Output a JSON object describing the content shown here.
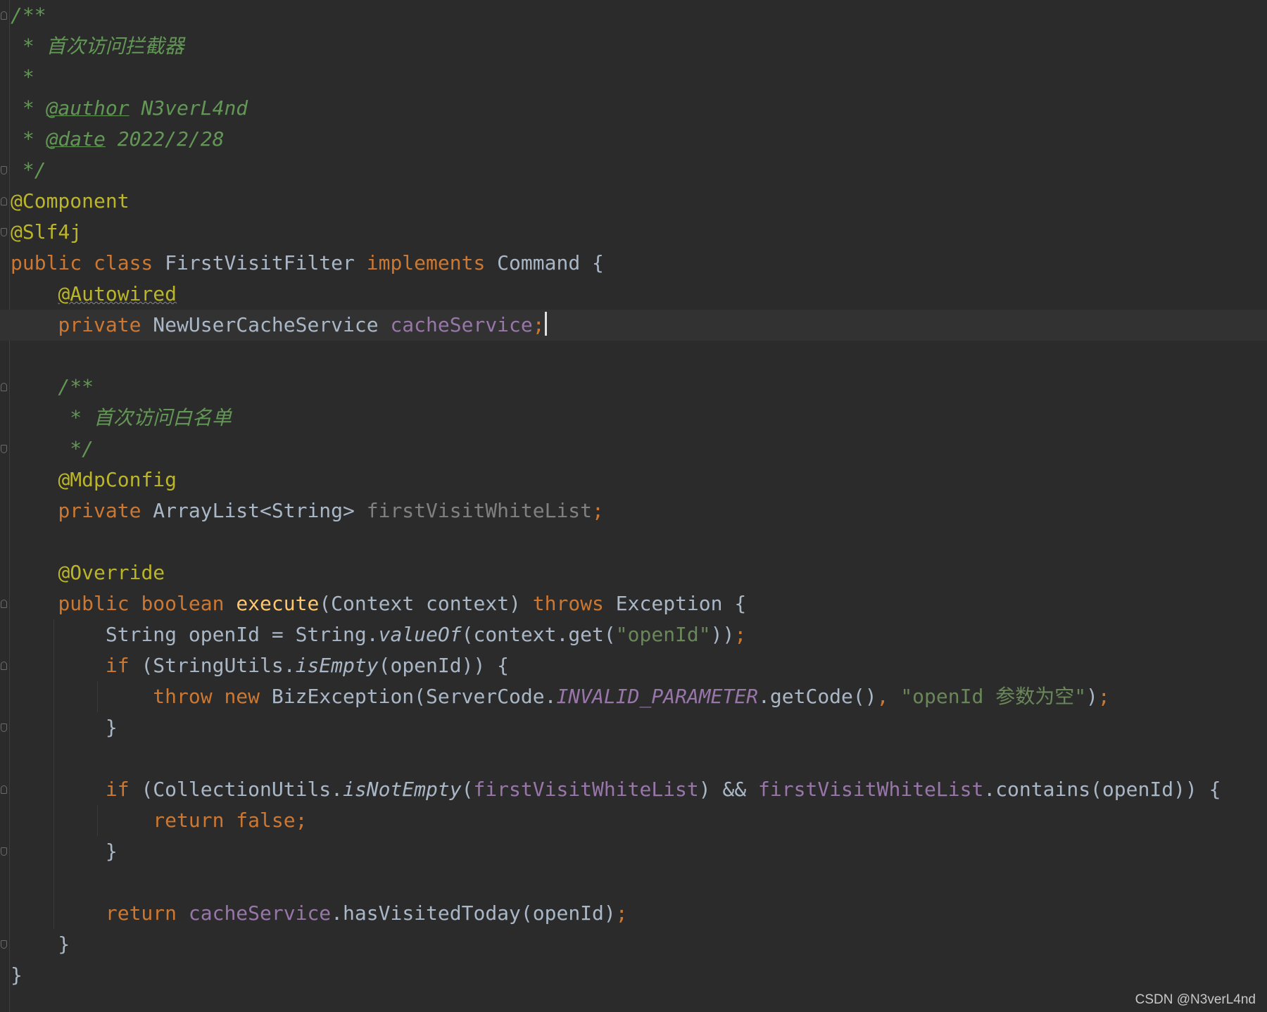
{
  "editor": {
    "lines": [
      [
        {
          "t": "/**",
          "c": "cm"
        }
      ],
      [
        {
          "t": " * 首次访问拦截器",
          "c": "cm"
        }
      ],
      [
        {
          "t": " *",
          "c": "cm"
        }
      ],
      [
        {
          "t": " * ",
          "c": "cm"
        },
        {
          "t": "@author",
          "c": "cmtag"
        },
        {
          "t": " N3verL4nd",
          "c": "cm"
        }
      ],
      [
        {
          "t": " * ",
          "c": "cm"
        },
        {
          "t": "@date",
          "c": "cmtag"
        },
        {
          "t": " 2022/2/28",
          "c": "cm"
        }
      ],
      [
        {
          "t": " */",
          "c": "cm"
        }
      ],
      [
        {
          "t": "@Component",
          "c": "ann"
        }
      ],
      [
        {
          "t": "@Slf4j",
          "c": "ann"
        }
      ],
      [
        {
          "t": "public class ",
          "c": "kw"
        },
        {
          "t": "FirstVisitFilter ",
          "c": "t"
        },
        {
          "t": "implements ",
          "c": "kw"
        },
        {
          "t": "Command {",
          "c": "t"
        }
      ],
      [
        {
          "t": "    ",
          "c": "t"
        },
        {
          "t": "@Autowired",
          "c": "ann squiggle"
        }
      ],
      [
        {
          "t": "    ",
          "c": "t"
        },
        {
          "t": "private ",
          "c": "kw"
        },
        {
          "t": "NewUserCacheService ",
          "c": "t"
        },
        {
          "t": "cacheService",
          "c": "fld"
        },
        {
          "t": ";",
          "c": "kw"
        },
        {
          "t": "",
          "c": "caret"
        }
      ],
      [],
      [
        {
          "t": "    /**",
          "c": "cm"
        }
      ],
      [
        {
          "t": "     * 首次访问白名单",
          "c": "cm"
        }
      ],
      [
        {
          "t": "     */",
          "c": "cm"
        }
      ],
      [
        {
          "t": "    ",
          "c": "t"
        },
        {
          "t": "@MdpConfig",
          "c": "ann"
        }
      ],
      [
        {
          "t": "    ",
          "c": "t"
        },
        {
          "t": "private ",
          "c": "kw"
        },
        {
          "t": "ArrayList<String> ",
          "c": "t"
        },
        {
          "t": "firstVisitWhiteList",
          "c": "fldgray"
        },
        {
          "t": ";",
          "c": "kw"
        }
      ],
      [],
      [
        {
          "t": "    ",
          "c": "t"
        },
        {
          "t": "@Override",
          "c": "ann"
        }
      ],
      [
        {
          "t": "    ",
          "c": "t"
        },
        {
          "t": "public boolean ",
          "c": "kw"
        },
        {
          "t": "execute",
          "c": "fn"
        },
        {
          "t": "(Context context) ",
          "c": "t"
        },
        {
          "t": "throws ",
          "c": "kw"
        },
        {
          "t": "Exception {",
          "c": "t"
        }
      ],
      [
        {
          "t": "        String openId = String.",
          "c": "t"
        },
        {
          "t": "valueOf",
          "c": "t ital"
        },
        {
          "t": "(context.get(",
          "c": "t"
        },
        {
          "t": "\"openId\"",
          "c": "str"
        },
        {
          "t": "))",
          "c": "t"
        },
        {
          "t": ";",
          "c": "kw"
        }
      ],
      [
        {
          "t": "        ",
          "c": "t"
        },
        {
          "t": "if ",
          "c": "kw"
        },
        {
          "t": "(StringUtils.",
          "c": "t"
        },
        {
          "t": "isEmpty",
          "c": "t ital"
        },
        {
          "t": "(openId)) {",
          "c": "t"
        }
      ],
      [
        {
          "t": "            ",
          "c": "t"
        },
        {
          "t": "throw new ",
          "c": "kw"
        },
        {
          "t": "BizException(ServerCode.",
          "c": "t"
        },
        {
          "t": "INVALID_PARAMETER",
          "c": "const"
        },
        {
          "t": ".getCode()",
          "c": "t"
        },
        {
          "t": ", ",
          "c": "kw"
        },
        {
          "t": "\"openId 参数为空\"",
          "c": "str"
        },
        {
          "t": ")",
          "c": "t"
        },
        {
          "t": ";",
          "c": "kw"
        }
      ],
      [
        {
          "t": "        }",
          "c": "t"
        }
      ],
      [],
      [
        {
          "t": "        ",
          "c": "t"
        },
        {
          "t": "if ",
          "c": "kw"
        },
        {
          "t": "(CollectionUtils.",
          "c": "t"
        },
        {
          "t": "isNotEmpty",
          "c": "t ital"
        },
        {
          "t": "(",
          "c": "t"
        },
        {
          "t": "firstVisitWhiteList",
          "c": "fld"
        },
        {
          "t": ") && ",
          "c": "t"
        },
        {
          "t": "firstVisitWhiteList",
          "c": "fld"
        },
        {
          "t": ".contains(openId)) {",
          "c": "t"
        }
      ],
      [
        {
          "t": "            ",
          "c": "t"
        },
        {
          "t": "return false;",
          "c": "kw"
        }
      ],
      [
        {
          "t": "        }",
          "c": "t"
        }
      ],
      [],
      [
        {
          "t": "        ",
          "c": "t"
        },
        {
          "t": "return ",
          "c": "kw"
        },
        {
          "t": "cacheService",
          "c": "fld"
        },
        {
          "t": ".hasVisitedToday(openId)",
          "c": "t"
        },
        {
          "t": ";",
          "c": "kw"
        }
      ],
      [
        {
          "t": "    }",
          "c": "t"
        }
      ],
      [
        {
          "t": "}",
          "c": "t"
        }
      ]
    ]
  },
  "watermark": {
    "text": "CSDN @N3verL4nd"
  }
}
